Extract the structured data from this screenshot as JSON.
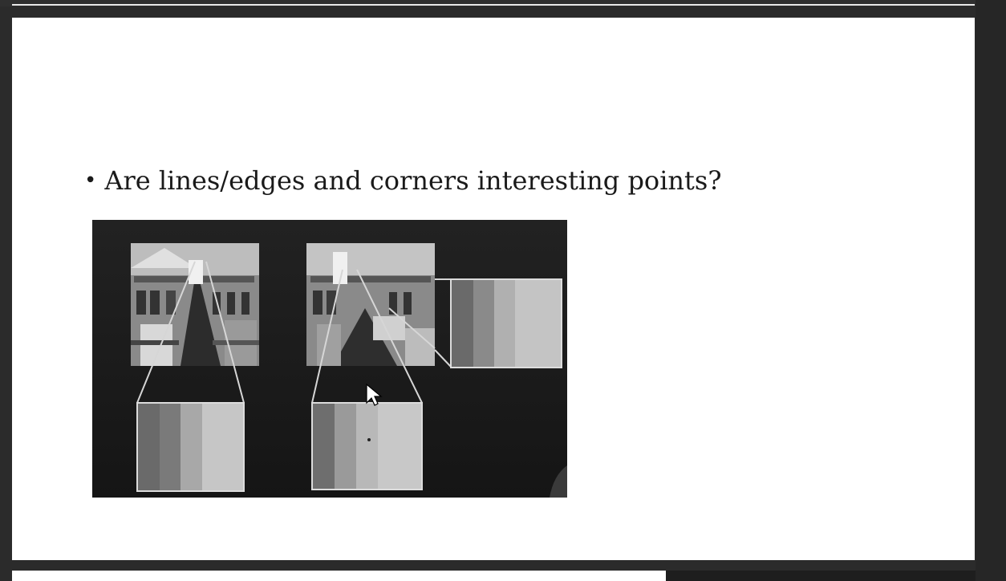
{
  "slide": {
    "bullet_symbol": "•",
    "bullet_text": "Are lines/edges and corners interesting points?"
  },
  "figure": {
    "icons": [
      "building-photo-left",
      "building-photo-right",
      "patch-flat",
      "patch-edge",
      "patch-corner",
      "mouse-cursor-icon"
    ]
  }
}
